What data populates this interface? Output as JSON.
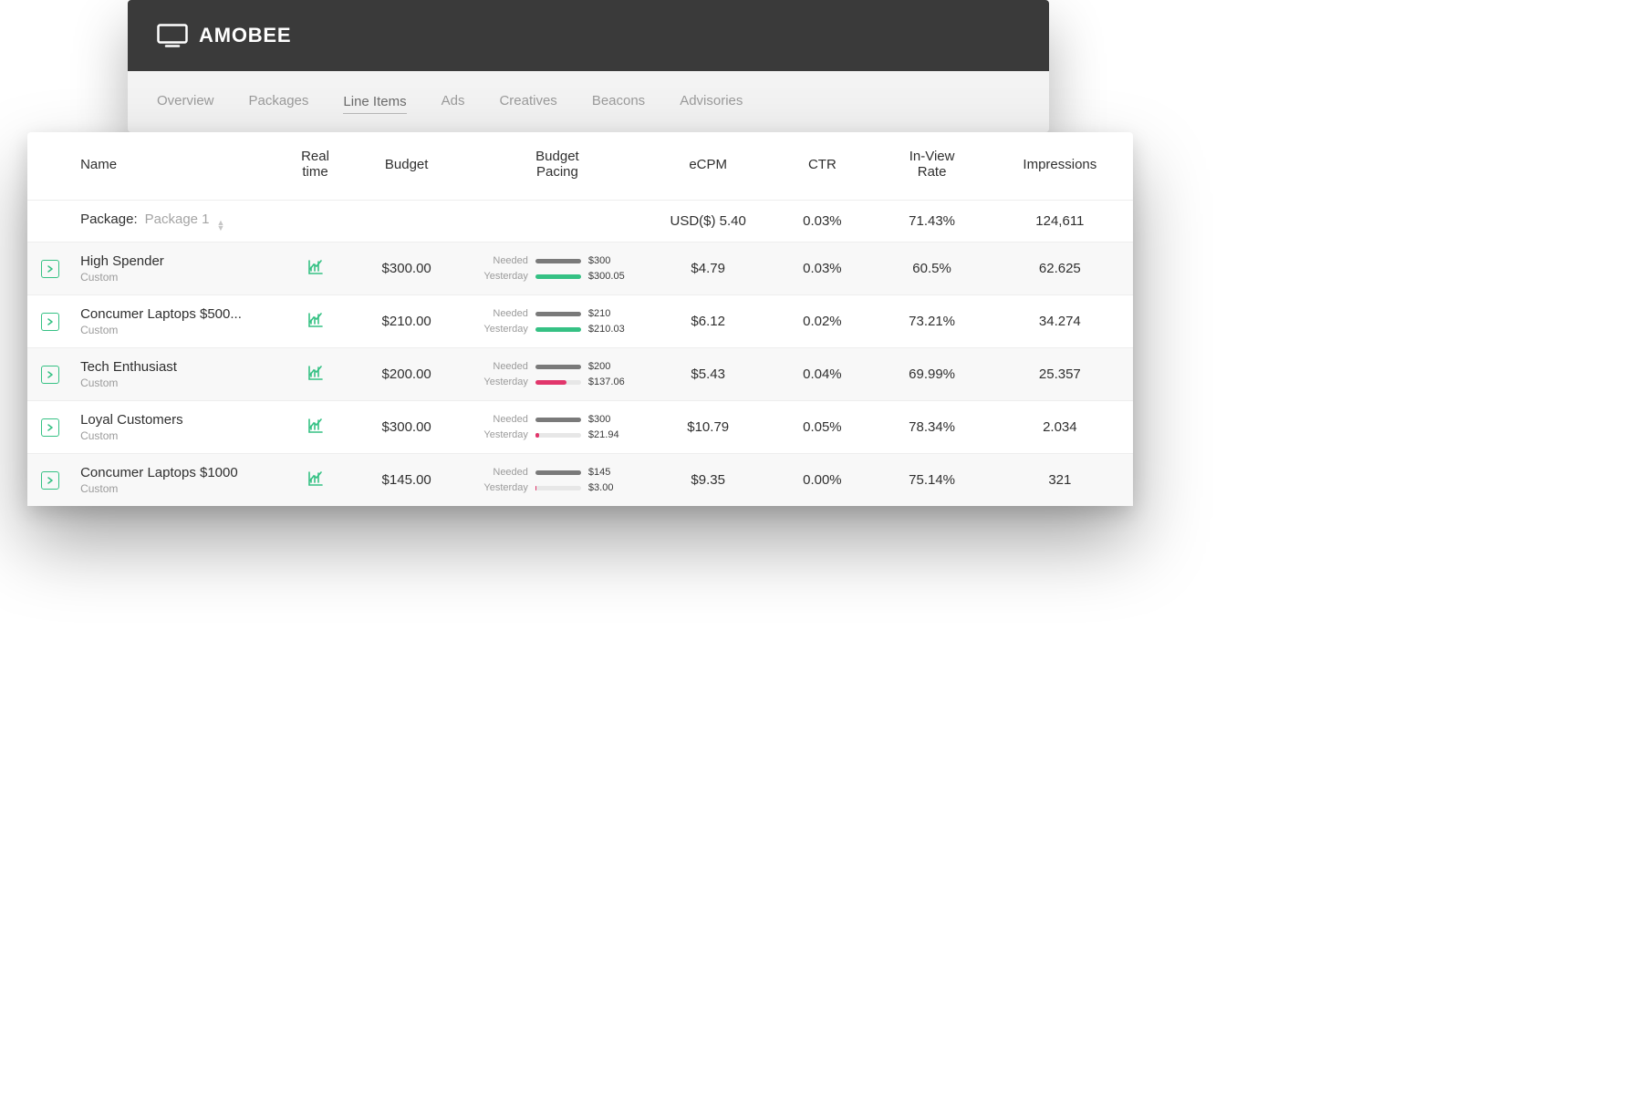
{
  "brand": "AMOBEE",
  "tabs": [
    "Overview",
    "Packages",
    "Line Items",
    "Ads",
    "Creatives",
    "Beacons",
    "Advisories"
  ],
  "active_tab": 2,
  "columns": {
    "name": "Name",
    "realtime": "Real\ntime",
    "budget": "Budget",
    "pacing": "Budget\nPacing",
    "ecpm": "eCPM",
    "ctr": "CTR",
    "inview": "In-View\nRate",
    "impr": "Impressions"
  },
  "pacing_labels": {
    "needed": "Needed",
    "yesterday": "Yesterday"
  },
  "group": {
    "label": "Package:",
    "value": "Package 1",
    "ecpm": "USD($) 5.40",
    "ctr": "0.03%",
    "inview": "71.43%",
    "impr": "124,611"
  },
  "rows": [
    {
      "name": "High Spender",
      "sub": "Custom",
      "budget": "$300.00",
      "needed": "$300",
      "yesterday": "$300.05",
      "pct": 100,
      "tone": "green",
      "ecpm": "$4.79",
      "ctr": "0.03%",
      "inview": "60.5%",
      "impr": "62.625"
    },
    {
      "name": "Concumer Laptops $500...",
      "sub": "Custom",
      "budget": "$210.00",
      "needed": "$210",
      "yesterday": "$210.03",
      "pct": 100,
      "tone": "green",
      "ecpm": "$6.12",
      "ctr": "0.02%",
      "inview": "73.21%",
      "impr": "34.274"
    },
    {
      "name": "Tech Enthusiast",
      "sub": "Custom",
      "budget": "$200.00",
      "needed": "$200",
      "yesterday": "$137.06",
      "pct": 68,
      "tone": "red",
      "ecpm": "$5.43",
      "ctr": "0.04%",
      "inview": "69.99%",
      "impr": "25.357"
    },
    {
      "name": "Loyal Customers",
      "sub": "Custom",
      "budget": "$300.00",
      "needed": "$300",
      "yesterday": "$21.94",
      "pct": 8,
      "tone": "red",
      "ecpm": "$10.79",
      "ctr": "0.05%",
      "inview": "78.34%",
      "impr": "2.034"
    },
    {
      "name": "Concumer Laptops $1000",
      "sub": "Custom",
      "budget": "$145.00",
      "needed": "$145",
      "yesterday": "$3.00",
      "pct": 3,
      "tone": "red",
      "ecpm": "$9.35",
      "ctr": "0.00%",
      "inview": "75.14%",
      "impr": "321"
    }
  ]
}
